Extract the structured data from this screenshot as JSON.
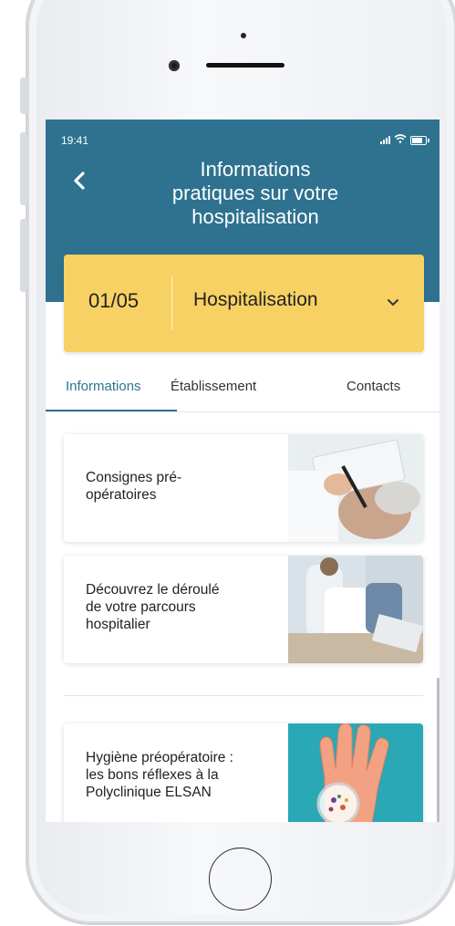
{
  "status_bar": {
    "time": "19:41"
  },
  "header": {
    "title_lines": [
      "Informations",
      "pratiques sur votre",
      "hospitalisation"
    ]
  },
  "selector": {
    "step": "01/05",
    "label": "Hospitalisation"
  },
  "tabs": [
    {
      "label": "Informations",
      "active": true
    },
    {
      "label": "Établissement",
      "active": false
    },
    {
      "label": "Contacts",
      "active": false
    }
  ],
  "cards": [
    {
      "lines": [
        "Consignes pré-",
        "opératoires"
      ],
      "image": "doctor-clipboard-patient-photo"
    },
    {
      "lines": [
        "Découvrez le déroulé",
        "de votre parcours",
        "hospitalier"
      ],
      "image": "doctors-consultation-photo"
    },
    {
      "lines": [
        "Hygiène préopératoire :",
        "les bons réflexes à la",
        "Polyclinique ELSAN"
      ],
      "image": "hand-bacteria-illustration"
    }
  ],
  "colors": {
    "header": "#2e7290",
    "selector": "#f7d163",
    "accent": "#2e7290"
  }
}
